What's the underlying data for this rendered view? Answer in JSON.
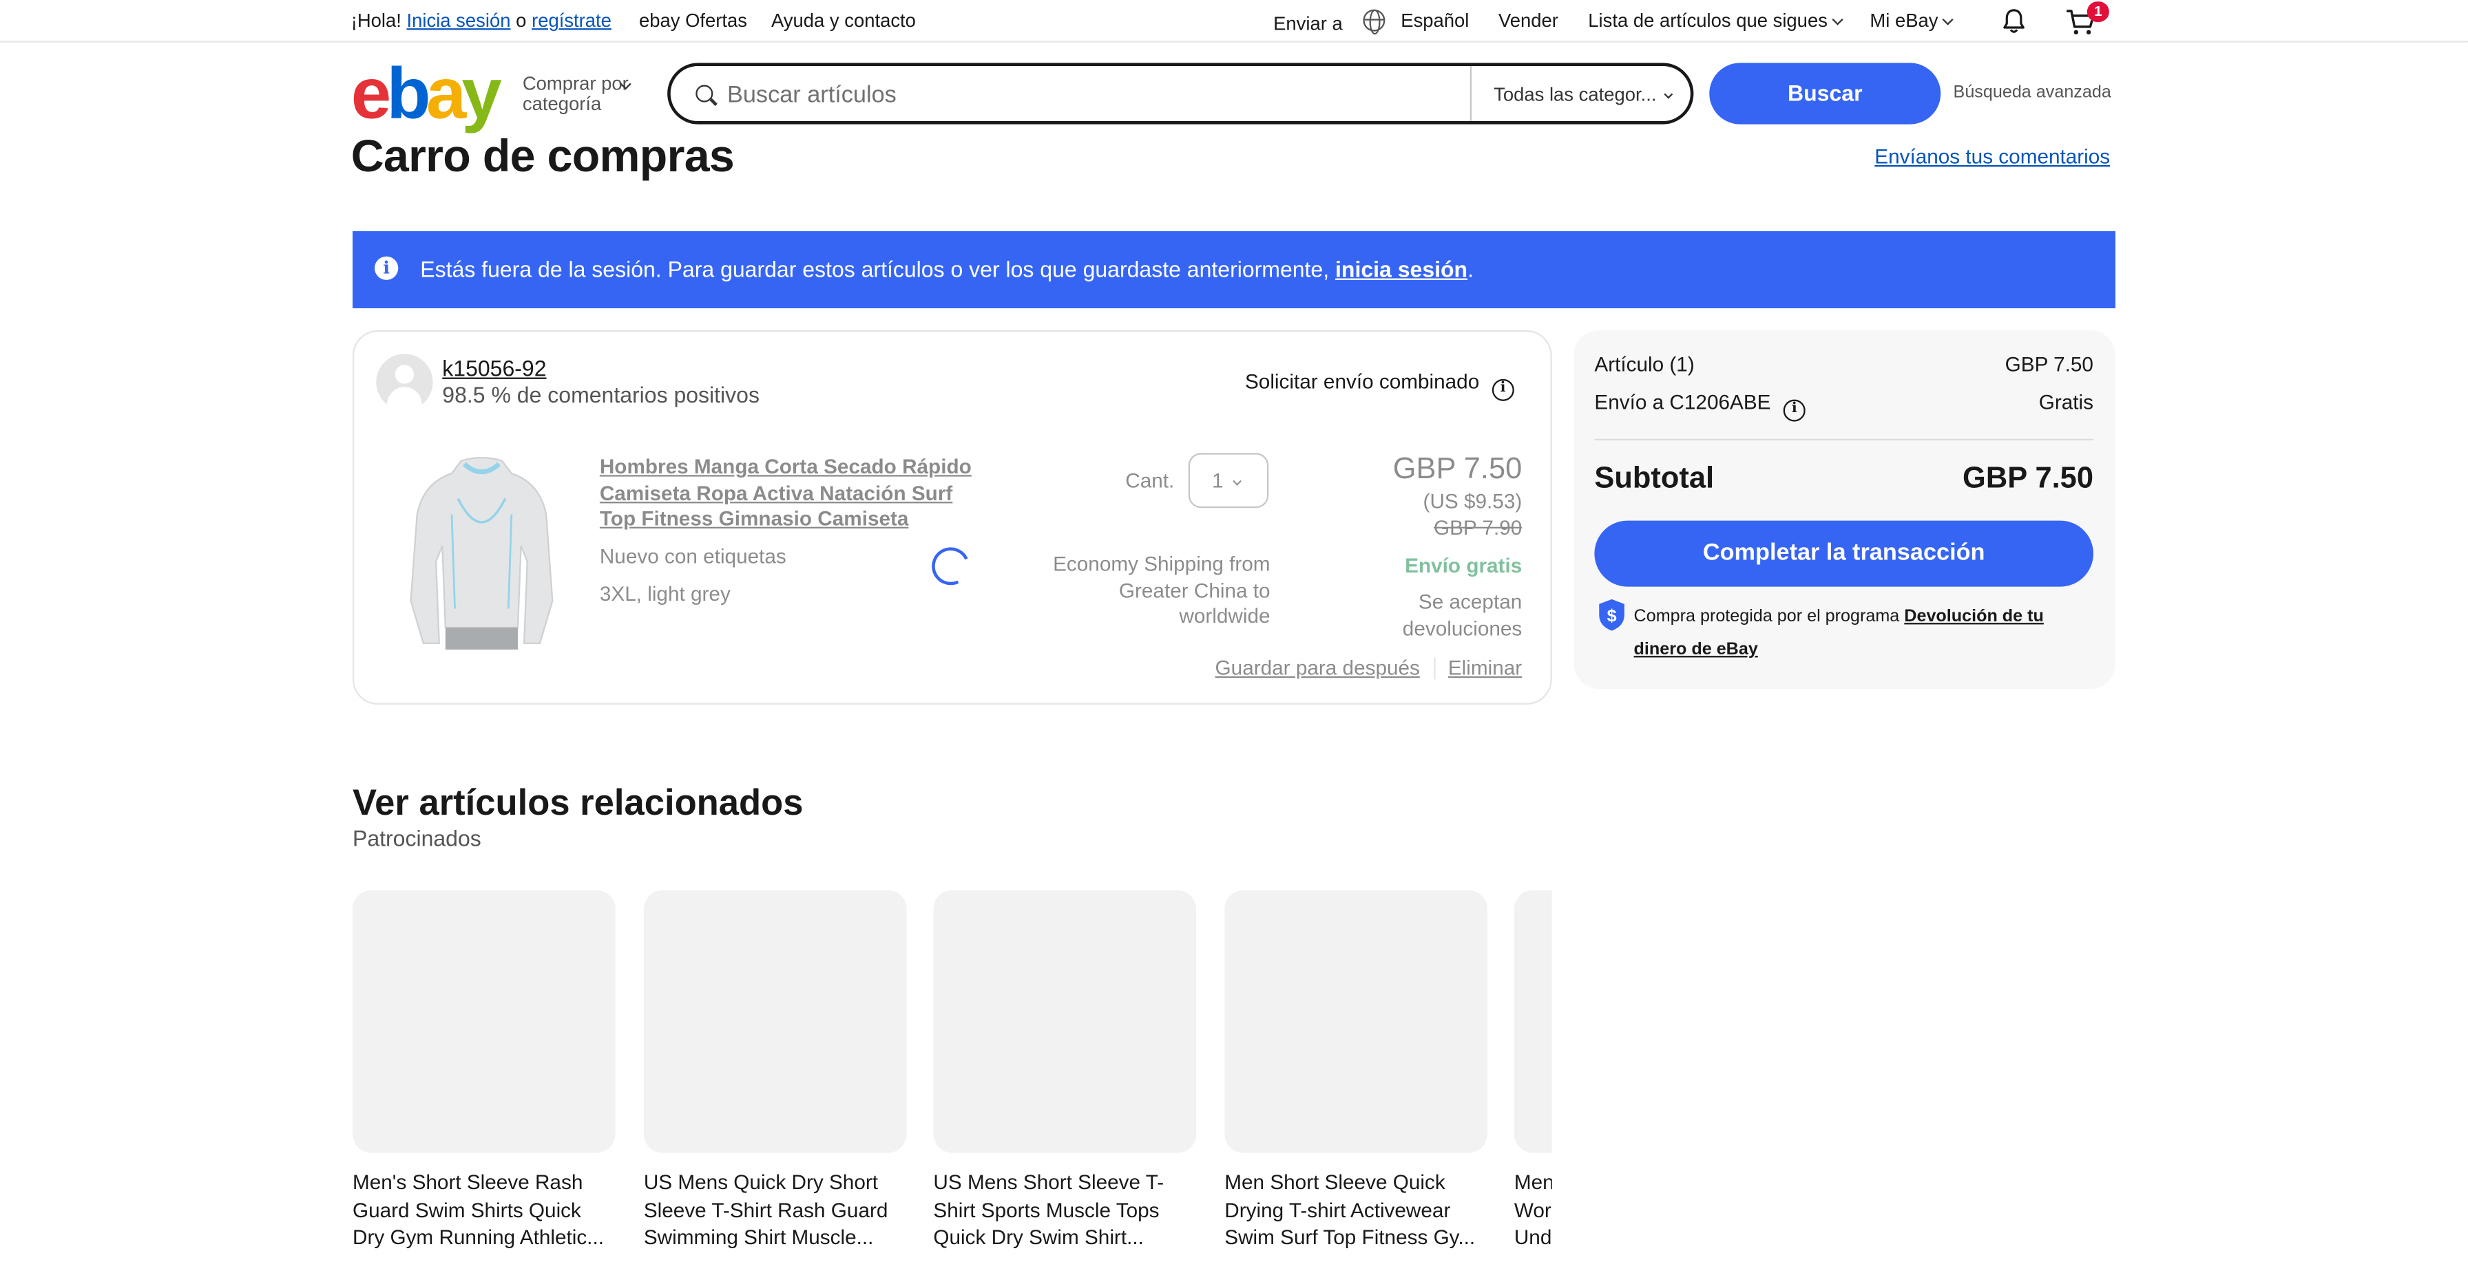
{
  "topbar": {
    "greeting": "¡Hola!",
    "signin": "Inicia sesión",
    "or": "o",
    "register": "regístrate",
    "deals": "ebay Ofertas",
    "help": "Ayuda y contacto",
    "ship_to": "Enviar a",
    "language": "Español",
    "sell": "Vender",
    "watchlist": "Lista de artículos que sigues",
    "my_ebay": "Mi eBay",
    "cart_count": "1"
  },
  "header": {
    "logo": {
      "e": "e",
      "b": "b",
      "a": "a",
      "y": "y"
    },
    "shop_by_category": "Comprar por categoría",
    "search_placeholder": "Buscar artículos",
    "category_select": "Todas las categor...",
    "search_button": "Buscar",
    "advanced": "Búsqueda avanzada"
  },
  "page": {
    "title": "Carro de compras",
    "feedback_link": "Envíanos tus comentarios"
  },
  "notice": {
    "text": "Estás fuera de la sesión. Para guardar estos artículos o ver los que guardaste anteriormente,",
    "link": "inicia sesión",
    "end": "."
  },
  "seller": {
    "name": "k15056-92",
    "feedback": "98.5 % de comentarios positivos",
    "combined_shipping": "Solicitar envío combinado"
  },
  "item": {
    "title": "Hombres Manga Corta Secado Rápido Camiseta Ropa Activa Natación Surf Top Fitness Gimnasio Camiseta",
    "condition": "Nuevo con etiquetas",
    "variation": "3XL, light grey",
    "qty_label": "Cant.",
    "qty_value": "1",
    "shipping_method": "Economy Shipping from Greater China to worldwide",
    "price": "GBP 7.50",
    "price_usd": "(US $9.53)",
    "price_original": "GBP 7.90",
    "free_shipping": "Envío gratis",
    "returns": "Se aceptan devoluciones",
    "save_for_later": "Guardar para después",
    "remove": "Eliminar"
  },
  "summary": {
    "items_label": "Artículo (1)",
    "items_value": "GBP 7.50",
    "shipping_label": "Envío a C1206ABE",
    "shipping_value": "Gratis",
    "subtotal_label": "Subtotal",
    "subtotal_value": "GBP 7.50",
    "checkout_button": "Completar la transacción",
    "protection_text": "Compra protegida por el programa",
    "protection_link": "Devolución de tu dinero de eBay"
  },
  "related": {
    "title": "Ver artículos relacionados",
    "subtitle": "Patrocinados",
    "items": [
      {
        "name": "Men's Short Sleeve Rash Guard Swim Shirts Quick Dry Gym Running Athletic..."
      },
      {
        "name": "US Mens Quick Dry Short Sleeve T-Shirt Rash Guard Swimming Shirt Muscle..."
      },
      {
        "name": "US Mens Short Sleeve T-Shirt Sports Muscle Tops Quick Dry Swim Shirt..."
      },
      {
        "name": "Men Short Sleeve Quick Drying T-shirt Activewear Swim Surf Top Fitness Gy..."
      },
      {
        "name": "Men Wor Und"
      }
    ]
  },
  "colors": {
    "accent": "#3665f3",
    "link": "#0654ba",
    "free_shipping": "#05823f",
    "badge": "#e0103a"
  }
}
